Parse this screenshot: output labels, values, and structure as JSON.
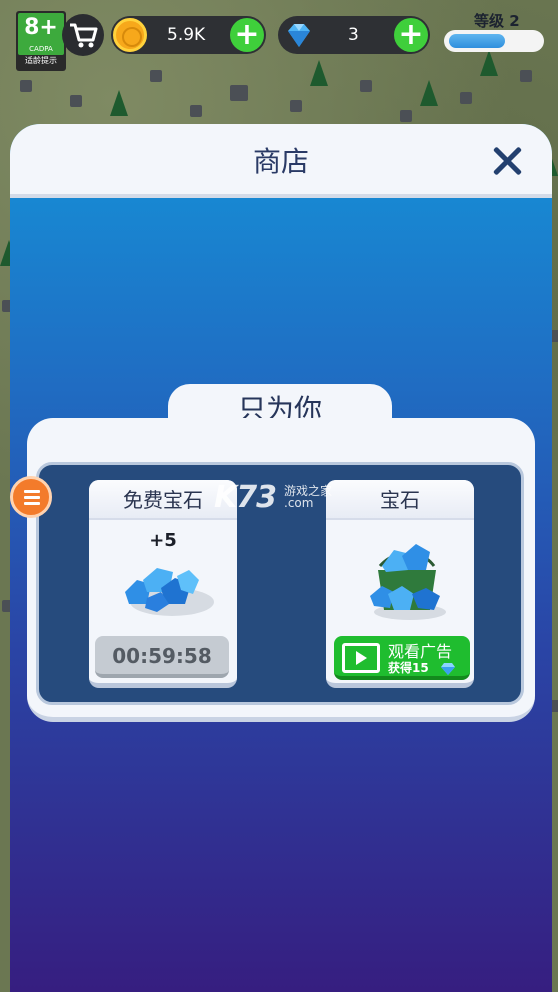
{
  "hud": {
    "age_rating": "8+",
    "age_org": "CADPA",
    "age_caption": "适龄提示",
    "coins": "5.9K",
    "gems": "3",
    "plus_symbol": "+",
    "level_label": "等级",
    "level_value": "2",
    "level_progress": 0.62
  },
  "shop": {
    "title": "商店",
    "section_title": "只为你",
    "free_gems": {
      "title": "免费宝石",
      "amount": "+5",
      "timer": "00:59:58"
    },
    "gems_offer": {
      "title": "宝石",
      "watch_label": "观看广告",
      "reward_label": "获得15"
    }
  },
  "watermark": {
    "logo": "K73",
    "text": "游戏之家",
    "domain": ".com"
  },
  "colors": {
    "accent_green": "#3fcf3b",
    "coin": "#f7a81b",
    "gem": "#2e8fe6",
    "menu_orange": "#f37b2b"
  },
  "icons": [
    "cart-icon",
    "coin-icon",
    "gem-icon",
    "plus-icon",
    "close-icon",
    "menu-icon",
    "film-icon"
  ]
}
